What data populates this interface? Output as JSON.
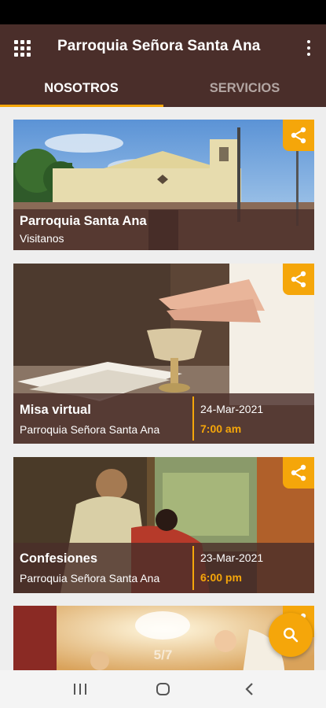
{
  "app_bar": {
    "title": "Parroquia Señora Santa Ana"
  },
  "tabs": [
    {
      "label": "NOSOTROS",
      "active": true
    },
    {
      "label": "SERVICIOS",
      "active": false
    }
  ],
  "cards": [
    {
      "title": "Parroquia Santa Ana",
      "subtitle": "Visitanos"
    },
    {
      "title": "Misa virtual",
      "subtitle": "Parroquia Señora Santa Ana",
      "date": "24-Mar-2021",
      "time": "7:00 am"
    },
    {
      "title": "Confesiones",
      "subtitle": "Parroquia Señora Santa Ana",
      "date": "23-Mar-2021",
      "time": "6:00 pm"
    }
  ],
  "page_indicator": "5/7",
  "colors": {
    "app_bar": "#4a2e2a",
    "accent": "#f5a60a",
    "overlay": "#4a2e2a"
  },
  "icons": [
    "apps-grid-icon",
    "more-vert-icon",
    "share-icon",
    "search-icon",
    "recents-icon",
    "home-icon",
    "back-icon"
  ]
}
